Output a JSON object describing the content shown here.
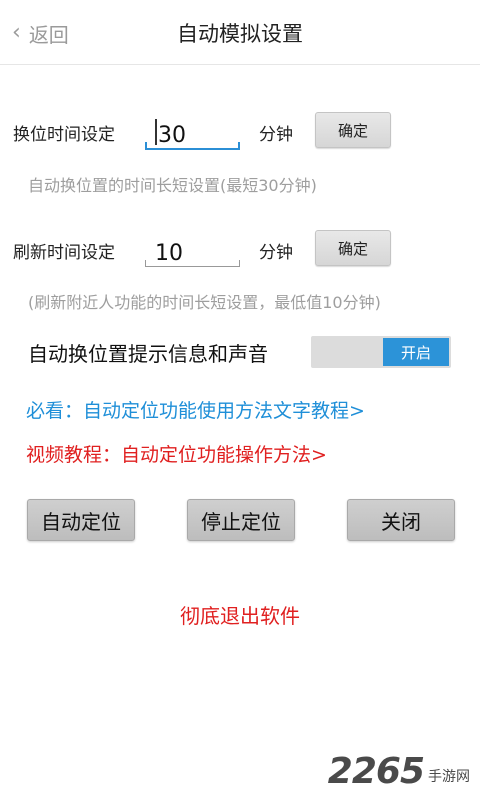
{
  "header": {
    "back_label": "返回",
    "title": "自动模拟设置"
  },
  "shift_interval": {
    "label": "换位时间设定",
    "value": "30",
    "unit": "分钟",
    "confirm_label": "确定",
    "hint": "自动换位置的时间长短设置(最短30分钟)"
  },
  "refresh_interval": {
    "label": "刷新时间设定",
    "value": "10",
    "unit": "分钟",
    "confirm_label": "确定",
    "hint": "(刷新附近人功能的时间长短设置，最低值10分钟)"
  },
  "notify_toggle": {
    "label": "自动换位置提示信息和声音",
    "state_label": "开启",
    "on": true
  },
  "links": {
    "text_tutorial": "必看：自动定位功能使用方法文字教程>",
    "video_tutorial": "视频教程：自动定位功能操作方法>"
  },
  "actions": {
    "auto_locate": "自动定位",
    "stop_locate": "停止定位",
    "close": "关闭"
  },
  "exit_label": "彻底退出软件",
  "watermark": {
    "brand": "2265",
    "sub": "手游网"
  },
  "colors": {
    "accent_blue": "#2c93d8",
    "link_blue": "#1f8fd8",
    "alert_red": "#e02020"
  }
}
